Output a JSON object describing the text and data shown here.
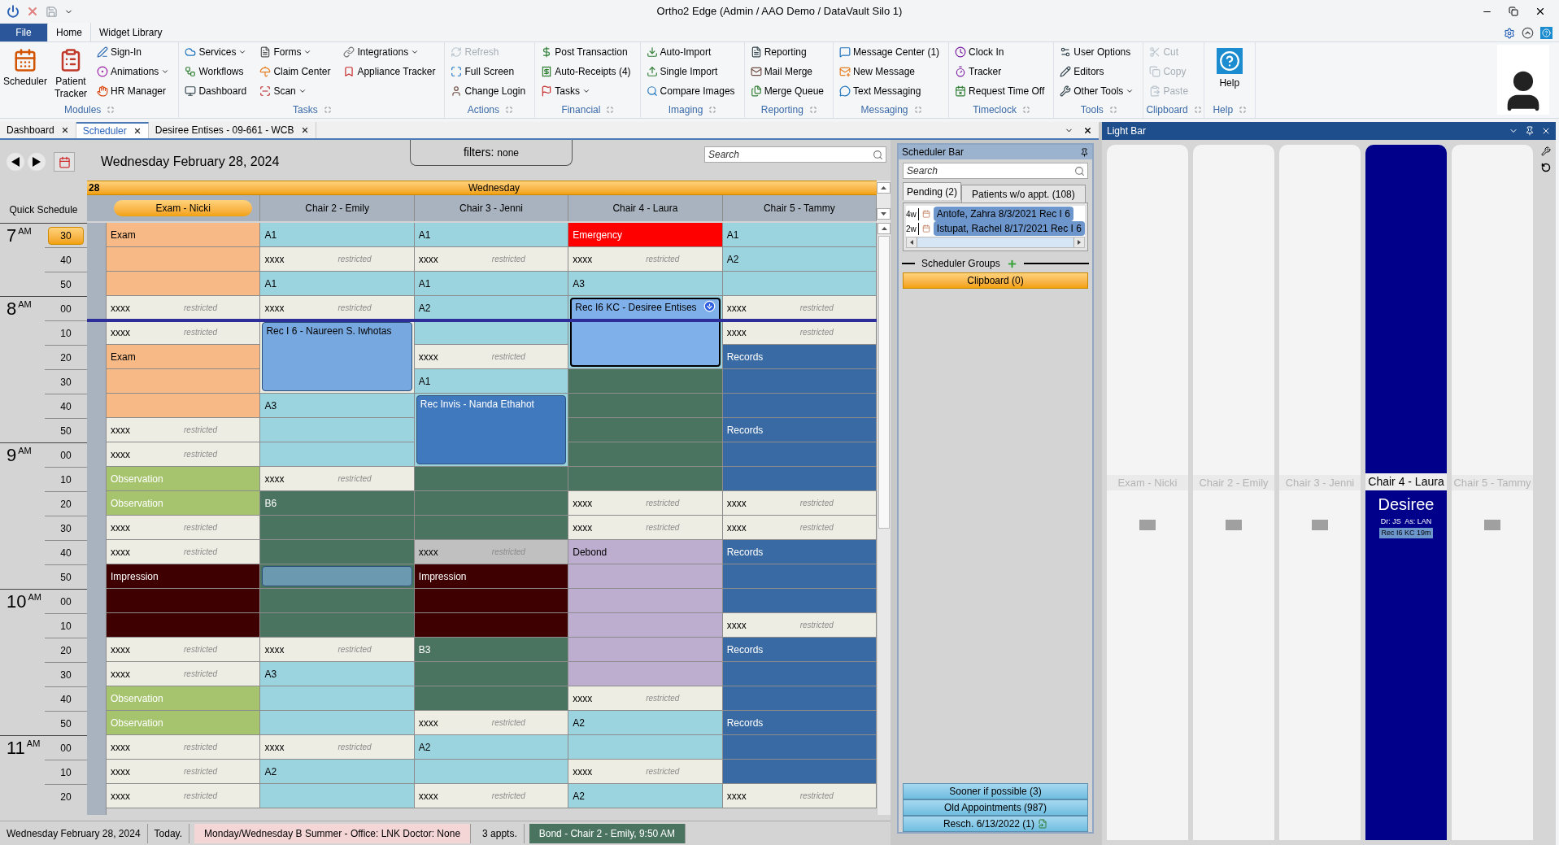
{
  "window": {
    "title": "Ortho2 Edge (Admin / AAO Demo / DataVault Silo 1)"
  },
  "ribbon_tabs": [
    {
      "label": "File",
      "kind": "file",
      "selected": false
    },
    {
      "label": "Home",
      "kind": "tab",
      "selected": true
    },
    {
      "label": "Widget Library",
      "kind": "tab",
      "selected": false
    }
  ],
  "ribbon_groups": [
    {
      "label": "Modules",
      "items": [
        {
          "label": "Scheduler",
          "kind": "large",
          "disabled": false
        },
        {
          "label": "Patient Tracker",
          "kind": "large",
          "disabled": false
        },
        {
          "label": "Sign-In",
          "kind": "small",
          "disabled": false
        },
        {
          "label": "Animations",
          "kind": "small",
          "dropdown": true,
          "disabled": false
        },
        {
          "label": "HR Manager",
          "kind": "small",
          "disabled": false
        }
      ]
    },
    {
      "label": "Tasks",
      "items": [
        {
          "label": "Services",
          "kind": "small",
          "dropdown": true,
          "disabled": false
        },
        {
          "label": "Workflows",
          "kind": "small",
          "disabled": false
        },
        {
          "label": "Dashboard",
          "kind": "small",
          "disabled": false
        },
        {
          "label": "Forms",
          "kind": "small",
          "dropdown": true,
          "disabled": false
        },
        {
          "label": "Claim Center",
          "kind": "small",
          "disabled": false
        },
        {
          "label": "Scan",
          "kind": "small",
          "dropdown": true,
          "disabled": false
        },
        {
          "label": "Integrations",
          "kind": "small",
          "dropdown": true,
          "disabled": false
        },
        {
          "label": "Appliance Tracker",
          "kind": "small",
          "disabled": false
        }
      ]
    },
    {
      "label": "Actions",
      "items": [
        {
          "label": "Refresh",
          "kind": "small",
          "disabled": true
        },
        {
          "label": "Full Screen",
          "kind": "small",
          "disabled": false
        },
        {
          "label": "Change Login",
          "kind": "small",
          "disabled": false
        }
      ]
    },
    {
      "label": "Financial",
      "items": [
        {
          "label": "Post Transaction",
          "kind": "small",
          "disabled": false
        },
        {
          "label": "Auto-Receipts (4)",
          "kind": "small",
          "disabled": false
        },
        {
          "label": "Tasks",
          "kind": "small",
          "dropdown": true,
          "disabled": false
        }
      ]
    },
    {
      "label": "Imaging",
      "items": [
        {
          "label": "Auto-Import",
          "kind": "small",
          "disabled": false
        },
        {
          "label": "Single Import",
          "kind": "small",
          "disabled": false
        },
        {
          "label": "Compare Images",
          "kind": "small",
          "disabled": false
        }
      ]
    },
    {
      "label": "Reporting",
      "items": [
        {
          "label": "Reporting",
          "kind": "small",
          "disabled": false
        },
        {
          "label": "Mail Merge",
          "kind": "small",
          "disabled": false
        },
        {
          "label": "Merge Queue",
          "kind": "small",
          "disabled": false
        }
      ]
    },
    {
      "label": "Messaging",
      "items": [
        {
          "label": "Message Center (1)",
          "kind": "small",
          "disabled": false
        },
        {
          "label": "New Message",
          "kind": "small",
          "disabled": false
        },
        {
          "label": "Text Messaging",
          "kind": "small",
          "disabled": false
        }
      ]
    },
    {
      "label": "Timeclock",
      "items": [
        {
          "label": "Clock In",
          "kind": "small",
          "disabled": false
        },
        {
          "label": "Tracker",
          "kind": "small",
          "disabled": false
        },
        {
          "label": "Request Time Off",
          "kind": "small",
          "disabled": false
        }
      ]
    },
    {
      "label": "Tools",
      "items": [
        {
          "label": "User Options",
          "kind": "small",
          "disabled": false
        },
        {
          "label": "Editors",
          "kind": "small",
          "disabled": false
        },
        {
          "label": "Other Tools",
          "kind": "small",
          "dropdown": true,
          "disabled": false
        }
      ]
    },
    {
      "label": "Clipboard",
      "items": [
        {
          "label": "Cut",
          "kind": "small",
          "disabled": true
        },
        {
          "label": "Copy",
          "kind": "small",
          "disabled": true
        },
        {
          "label": "Paste",
          "kind": "small",
          "disabled": true
        }
      ]
    },
    {
      "label": "Help",
      "items": [
        {
          "label": "Help",
          "kind": "large",
          "disabled": false
        }
      ]
    }
  ],
  "document_tabs": [
    {
      "label": "Dashboard",
      "selected": false
    },
    {
      "label": "Scheduler",
      "selected": true
    },
    {
      "label": "Desiree Entises - 09-661 - WCB",
      "selected": false
    }
  ],
  "scheduler": {
    "date": "Wednesday February 28, 2024",
    "filters_label": "filters:",
    "filters_value": "none",
    "search": {
      "placeholder": "Search"
    },
    "day_number": "28",
    "day_name": "Wednesday",
    "quick_schedule": "Quick Schedule",
    "times": [
      {
        "hour": "7",
        "suffix": "AM",
        "minutes": [
          {
            "label": "30",
            "selected": true
          },
          {
            "label": "40",
            "selected": false
          },
          {
            "label": "50",
            "selected": false
          }
        ]
      },
      {
        "hour": "8",
        "suffix": "AM",
        "minutes": [
          {
            "label": "00",
            "selected": false
          },
          {
            "label": "10",
            "selected": false
          },
          {
            "label": "20",
            "selected": false
          },
          {
            "label": "30",
            "selected": false
          },
          {
            "label": "40",
            "selected": false
          },
          {
            "label": "50",
            "selected": false
          }
        ]
      },
      {
        "hour": "9",
        "suffix": "AM",
        "minutes": [
          {
            "label": "00",
            "selected": false
          },
          {
            "label": "10",
            "selected": false
          },
          {
            "label": "20",
            "selected": false
          },
          {
            "label": "30",
            "selected": false
          },
          {
            "label": "40",
            "selected": false
          },
          {
            "label": "50",
            "selected": false
          }
        ]
      },
      {
        "hour": "10",
        "suffix": "AM",
        "minutes": [
          {
            "label": "00",
            "selected": false
          },
          {
            "label": "10",
            "selected": false
          },
          {
            "label": "20",
            "selected": false
          },
          {
            "label": "30",
            "selected": false
          },
          {
            "label": "40",
            "selected": false
          },
          {
            "label": "50",
            "selected": false
          }
        ]
      },
      {
        "hour": "11",
        "suffix": "AM",
        "minutes": [
          {
            "label": "00",
            "selected": false
          },
          {
            "label": "10",
            "selected": false
          },
          {
            "label": "20",
            "selected": false
          }
        ]
      }
    ],
    "columns": [
      {
        "name": "Exam - Nicki",
        "selected": true,
        "cells": [
          {
            "kind": "slot",
            "label": "Exam",
            "color": "#f7b985"
          },
          {
            "kind": "slot",
            "color": "#f7b985"
          },
          {
            "kind": "slot",
            "color": "#f7b985"
          },
          {
            "kind": "restricted",
            "label": "xxxx",
            "note": "restricted",
            "color": "#eeede3"
          },
          {
            "kind": "restricted",
            "label": "xxxx",
            "note": "restricted",
            "color": "#eeede3"
          },
          {
            "kind": "slot",
            "label": "Exam",
            "color": "#f7b985"
          },
          {
            "kind": "slot",
            "color": "#f7b985"
          },
          {
            "kind": "slot",
            "color": "#f7b985"
          },
          {
            "kind": "restricted",
            "label": "xxxx",
            "note": "restricted",
            "color": "#eeede3"
          },
          {
            "kind": "restricted",
            "label": "xxxx",
            "note": "restricted",
            "color": "#eeede3"
          },
          {
            "kind": "slot",
            "label": "Observation",
            "color": "#a6c46e"
          },
          {
            "kind": "slot",
            "label": "Observation",
            "color": "#a6c46e"
          },
          {
            "kind": "restricted",
            "label": "xxxx",
            "note": "restricted",
            "color": "#eeede3"
          },
          {
            "kind": "restricted",
            "label": "xxxx",
            "note": "restricted",
            "color": "#eeede3"
          },
          {
            "kind": "slot",
            "label": "Impression",
            "color": "#3e0000"
          },
          {
            "kind": "slot",
            "color": "#3e0000"
          },
          {
            "kind": "slot",
            "color": "#3e0000"
          },
          {
            "kind": "restricted",
            "label": "xxxx",
            "note": "restricted",
            "color": "#eeede3"
          },
          {
            "kind": "restricted",
            "label": "xxxx",
            "note": "restricted",
            "color": "#eeede3"
          },
          {
            "kind": "slot",
            "label": "Observation",
            "color": "#a6c46e"
          },
          {
            "kind": "slot",
            "label": "Observation",
            "color": "#a6c46e"
          },
          {
            "kind": "restricted",
            "label": "xxxx",
            "note": "restricted",
            "color": "#eeede3"
          },
          {
            "kind": "restricted",
            "label": "xxxx",
            "note": "restricted",
            "color": "#eeede3"
          },
          {
            "kind": "restricted",
            "label": "xxxx",
            "note": "restricted",
            "color": "#eeede3"
          }
        ]
      },
      {
        "name": "Chair 2 - Emily",
        "selected": false,
        "cells": [
          {
            "kind": "slot",
            "label": "A1",
            "color": "#9bd3df"
          },
          {
            "kind": "restricted",
            "label": "xxxx",
            "note": "restricted",
            "color": "#eeede3"
          },
          {
            "kind": "slot",
            "label": "A1",
            "color": "#9bd3df"
          },
          {
            "kind": "restricted",
            "label": "xxxx",
            "note": "restricted",
            "color": "#eeede3"
          },
          {
            "kind": "appt",
            "label": "Rec I 6 - Naureen S. Iwhotas",
            "color": "#78a8e0",
            "selected": false
          },
          {
            "kind": "appt_continued"
          },
          {
            "kind": "appt_continued"
          },
          {
            "kind": "slot",
            "label": "A3",
            "color": "#9bd3df"
          },
          {
            "kind": "slot",
            "color": "#9bd3df"
          },
          {
            "kind": "slot",
            "color": "#9bd3df"
          },
          {
            "kind": "restricted",
            "label": "xxxx",
            "note": "restricted",
            "color": "#eeede3"
          },
          {
            "kind": "slot",
            "label": "B6",
            "color": "#4a7360"
          },
          {
            "kind": "slot",
            "color": "#4a7360"
          },
          {
            "kind": "slot",
            "color": "#4a7360"
          },
          {
            "kind": "appt",
            "color": "#6b9ab0",
            "selected": false
          },
          {
            "kind": "slot",
            "color": "#4a7360"
          },
          {
            "kind": "slot",
            "color": "#4a7360"
          },
          {
            "kind": "restricted",
            "label": "xxxx",
            "note": "restricted",
            "color": "#eeede3"
          },
          {
            "kind": "slot",
            "label": "A3",
            "color": "#9bd3df"
          },
          {
            "kind": "slot",
            "color": "#9bd3df"
          },
          {
            "kind": "slot",
            "color": "#9bd3df"
          },
          {
            "kind": "restricted",
            "label": "xxxx",
            "note": "restricted",
            "color": "#eeede3"
          },
          {
            "kind": "slot",
            "label": "A2",
            "color": "#9bd3df"
          },
          {
            "kind": "slot",
            "color": "#9bd3df"
          }
        ]
      },
      {
        "name": "Chair 3 - Jenni",
        "selected": false,
        "cells": [
          {
            "kind": "slot",
            "label": "A1",
            "color": "#9bd3df"
          },
          {
            "kind": "restricted",
            "label": "xxxx",
            "note": "restricted",
            "color": "#eeede3"
          },
          {
            "kind": "slot",
            "label": "A1",
            "color": "#9bd3df"
          },
          {
            "kind": "slot",
            "label": "A2",
            "color": "#9bd3df"
          },
          {
            "kind": "slot",
            "color": "#9bd3df"
          },
          {
            "kind": "restricted",
            "label": "xxxx",
            "note": "restricted",
            "color": "#eeede3"
          },
          {
            "kind": "slot",
            "label": "A1",
            "color": "#9bd3df"
          },
          {
            "kind": "appt",
            "label": "Rec Invis - Nanda Ethahot",
            "color": "#4179bf",
            "selected": false
          },
          {
            "kind": "appt_continued"
          },
          {
            "kind": "appt_continued"
          },
          {
            "kind": "slot",
            "color": "#4a7360"
          },
          {
            "kind": "slot",
            "color": "#4a7360"
          },
          {
            "kind": "slot",
            "color": "#4a7360"
          },
          {
            "kind": "restricted",
            "label": "xxxx",
            "note": "restricted",
            "color": "#c0c0c0"
          },
          {
            "kind": "slot",
            "label": "Impression",
            "color": "#3e0000"
          },
          {
            "kind": "slot",
            "color": "#3e0000"
          },
          {
            "kind": "slot",
            "color": "#3e0000"
          },
          {
            "kind": "slot",
            "label": "B3",
            "color": "#4a7360"
          },
          {
            "kind": "slot",
            "color": "#4a7360"
          },
          {
            "kind": "slot",
            "color": "#4a7360"
          },
          {
            "kind": "restricted",
            "label": "xxxx",
            "note": "restricted",
            "color": "#eeede3"
          },
          {
            "kind": "slot",
            "label": "A2",
            "color": "#9bd3df"
          },
          {
            "kind": "slot",
            "color": "#9bd3df"
          },
          {
            "kind": "restricted",
            "label": "xxxx",
            "note": "restricted",
            "color": "#eeede3"
          }
        ]
      },
      {
        "name": "Chair 4 - Laura",
        "selected": false,
        "cells": [
          {
            "kind": "slot",
            "label": "Emergency",
            "color": "#ff0000"
          },
          {
            "kind": "restricted",
            "label": "xxxx",
            "note": "restricted",
            "color": "#eeede3"
          },
          {
            "kind": "slot",
            "label": "A3",
            "color": "#9bd3df"
          },
          {
            "kind": "appt",
            "label": "Rec I6 KC - Desiree Entises",
            "color": "#7fb0ea",
            "selected": true
          },
          {
            "kind": "appt_continued"
          },
          {
            "kind": "appt_continued"
          },
          {
            "kind": "slot",
            "color": "#4a7360"
          },
          {
            "kind": "slot",
            "color": "#4a7360"
          },
          {
            "kind": "slot",
            "color": "#4a7360"
          },
          {
            "kind": "slot",
            "color": "#4a7360"
          },
          {
            "kind": "slot",
            "color": "#4a7360"
          },
          {
            "kind": "restricted",
            "label": "xxxx",
            "note": "restricted",
            "color": "#eeede3"
          },
          {
            "kind": "restricted",
            "label": "xxxx",
            "note": "restricted",
            "color": "#eeede3"
          },
          {
            "kind": "slot",
            "label": "Debond",
            "color": "#bdaed0"
          },
          {
            "kind": "slot",
            "color": "#bdaed0"
          },
          {
            "kind": "slot",
            "color": "#bdaed0"
          },
          {
            "kind": "slot",
            "color": "#bdaed0"
          },
          {
            "kind": "slot",
            "color": "#bdaed0"
          },
          {
            "kind": "slot",
            "color": "#bdaed0"
          },
          {
            "kind": "restricted",
            "label": "xxxx",
            "note": "restricted",
            "color": "#eeede3"
          },
          {
            "kind": "slot",
            "label": "A2",
            "color": "#9bd3df"
          },
          {
            "kind": "slot",
            "color": "#9bd3df"
          },
          {
            "kind": "restricted",
            "label": "xxxx",
            "note": "restricted",
            "color": "#eeede3"
          },
          {
            "kind": "slot",
            "label": "A2",
            "color": "#9bd3df"
          }
        ]
      },
      {
        "name": "Chair 5 - Tammy",
        "selected": false,
        "cells": [
          {
            "kind": "slot",
            "label": "A1",
            "color": "#9bd3df"
          },
          {
            "kind": "slot",
            "label": "A2",
            "color": "#9bd3df"
          },
          {
            "kind": "slot",
            "color": "#9bd3df"
          },
          {
            "kind": "restricted",
            "label": "xxxx",
            "note": "restricted",
            "color": "#eeede3"
          },
          {
            "kind": "restricted",
            "label": "xxxx",
            "note": "restricted",
            "color": "#eeede3"
          },
          {
            "kind": "slot",
            "label": "Records",
            "color": "#3a6aa3"
          },
          {
            "kind": "slot",
            "color": "#3a6aa3"
          },
          {
            "kind": "slot",
            "color": "#3a6aa3"
          },
          {
            "kind": "slot",
            "label": "Records",
            "color": "#3a6aa3"
          },
          {
            "kind": "slot",
            "color": "#3a6aa3"
          },
          {
            "kind": "slot",
            "color": "#3a6aa3"
          },
          {
            "kind": "restricted",
            "label": "xxxx",
            "note": "restricted",
            "color": "#eeede3"
          },
          {
            "kind": "restricted",
            "label": "xxxx",
            "note": "restricted",
            "color": "#eeede3"
          },
          {
            "kind": "slot",
            "label": "Records",
            "color": "#3a6aa3"
          },
          {
            "kind": "slot",
            "color": "#3a6aa3"
          },
          {
            "kind": "slot",
            "color": "#3a6aa3"
          },
          {
            "kind": "restricted",
            "label": "xxxx",
            "note": "restricted",
            "color": "#eeede3"
          },
          {
            "kind": "slot",
            "label": "Records",
            "color": "#3a6aa3"
          },
          {
            "kind": "slot",
            "color": "#3a6aa3"
          },
          {
            "kind": "slot",
            "color": "#3a6aa3"
          },
          {
            "kind": "slot",
            "label": "Records",
            "color": "#3a6aa3"
          },
          {
            "kind": "slot",
            "color": "#3a6aa3"
          },
          {
            "kind": "slot",
            "color": "#3a6aa3"
          },
          {
            "kind": "restricted",
            "label": "xxxx",
            "note": "restricted",
            "color": "#eeede3"
          }
        ]
      }
    ]
  },
  "status_bar": [
    {
      "label": "Wednesday February 28, 2024",
      "kind": "plain"
    },
    {
      "label": "Today.",
      "kind": "plain"
    },
    {
      "label": "Monday/Wednesday B Summer -  Office: LNK  Doctor: None",
      "kind": "schedule"
    },
    {
      "label": "3 appts.",
      "kind": "plain"
    },
    {
      "label": "Bond - Chair 2 - Emily, 9:50 AM",
      "kind": "appointment"
    }
  ],
  "scheduler_bar": {
    "title": "Scheduler Bar",
    "search": {
      "placeholder": "Search"
    },
    "tabs": [
      {
        "label": "Pending (2)",
        "selected": true
      },
      {
        "label": "Patients w/o appt. (108)",
        "selected": false
      }
    ],
    "pending": [
      {
        "weeks": "4w",
        "text": "Antofe, Zahra 8/3/2021 Rec I 6"
      },
      {
        "weeks": "2w",
        "text": "Istupat, Rachel 8/17/2021 Rec I 6"
      }
    ],
    "groups_title": "Scheduler Groups",
    "clipboard": "Clipboard (0)",
    "bottom_groups": [
      {
        "label": "Sooner if possible (3)",
        "icon": false
      },
      {
        "label": "Old Appointments (987)",
        "icon": false
      },
      {
        "label": "Resch. 6/13/2022 (1)",
        "icon": true
      }
    ]
  },
  "light_bar": {
    "title": "Light Bar",
    "chairs": [
      {
        "name": "Exam - Nicki",
        "selected": false
      },
      {
        "name": "Chair 2 - Emily",
        "selected": false
      },
      {
        "name": "Chair 3 - Jenni",
        "selected": false
      },
      {
        "name": "Chair 4 - Laura",
        "selected": true,
        "patient": "Desiree",
        "staff": "Dr: JS  As: LAN",
        "appointment": "Rec I6 KC 19m"
      },
      {
        "name": "Chair 5 - Tammy",
        "selected": false
      }
    ]
  }
}
